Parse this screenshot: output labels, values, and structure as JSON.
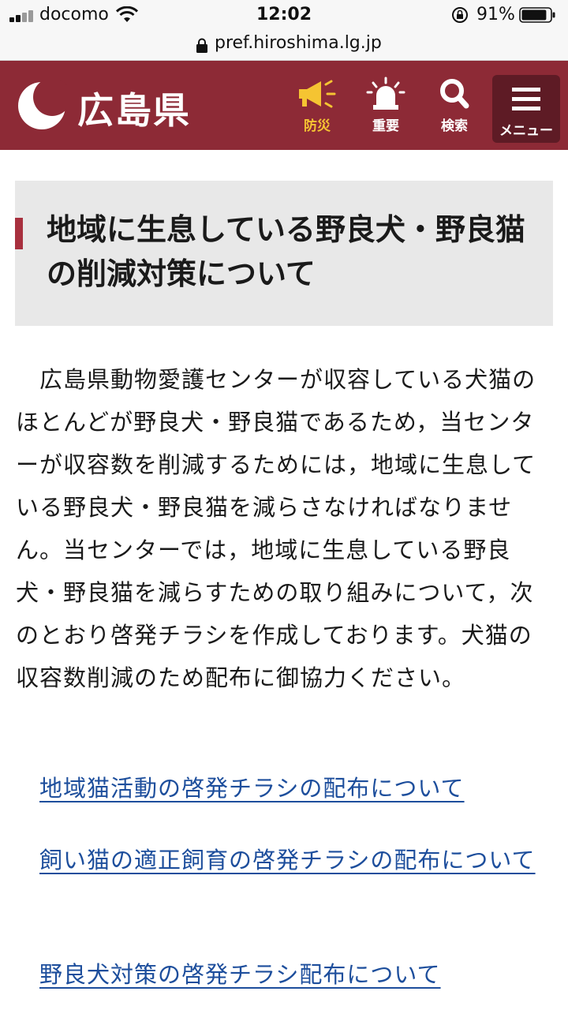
{
  "status_bar": {
    "carrier": "docomo",
    "time": "12:02",
    "battery": "91%",
    "battery_level": 0.91
  },
  "browser": {
    "url": "pref.hiroshima.lg.jp"
  },
  "header": {
    "logo_text": "広島県",
    "nav": [
      {
        "label": "防災",
        "icon": "megaphone-icon",
        "color": "#f5c432"
      },
      {
        "label": "重要",
        "icon": "alert-siren-icon",
        "color": "#ffffff"
      },
      {
        "label": "検索",
        "icon": "search-icon",
        "color": "#ffffff"
      },
      {
        "label": "メニュー",
        "icon": "hamburger-menu-icon",
        "color": "#ffffff"
      }
    ],
    "background": "#8d2a36"
  },
  "article": {
    "title": "地域に生息している野良犬・野良猫の削減対策について",
    "intro": "広島県動物愛護センターが収容している犬猫のほとんどが野良犬・野良猫であるため，当センターが収容数を削減するためには，地域に生息している野良犬・野良猫を減らさなければなりません。当センターでは，地域に生息している野良犬・野良猫を減らすための取り組みについて，次のとおり啓発チラシを作成しております。犬猫の収容数削減のため配布に御協力ください。",
    "links": [
      "地域猫活動の啓発チラシの配布について",
      "飼い猫の適正飼育の啓発チラシの配布について",
      "野良犬対策の啓発チラシ配布について"
    ],
    "accent": "#a8303e",
    "link_color": "#1d4e9c"
  }
}
